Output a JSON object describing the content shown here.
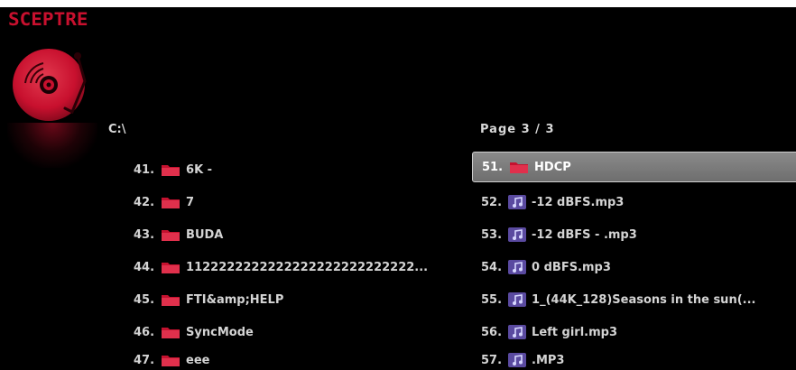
{
  "brand": {
    "logo": "SCEPTRE"
  },
  "header": {
    "path": "C:\\",
    "page": "Page  3 / 3"
  },
  "colors": {
    "brand_red": "#c8102e",
    "folder": "#c4122f",
    "music": "#5a4aa0"
  },
  "left_list": [
    {
      "index": "41.",
      "name": "6K -",
      "icon": "folder-icon"
    },
    {
      "index": "42.",
      "name": "7",
      "icon": "folder-icon"
    },
    {
      "index": "43.",
      "name": "BUDA",
      "icon": "folder-icon"
    },
    {
      "index": "44.",
      "name": "1122222222222222222222222222...",
      "icon": "folder-icon"
    },
    {
      "index": "45.",
      "name": "FTI&amp;HELP",
      "icon": "folder-icon"
    },
    {
      "index": "46.",
      "name": "SyncMode",
      "icon": "folder-icon"
    },
    {
      "index": "47.",
      "name": "eee",
      "icon": "folder-icon"
    }
  ],
  "right_list": [
    {
      "index": "51.",
      "name": "HDCP",
      "icon": "folder-icon",
      "selected": true
    },
    {
      "index": "52.",
      "name": "-12 dBFS.mp3",
      "icon": "music-icon"
    },
    {
      "index": "53.",
      "name": "-12 dBFS - .mp3",
      "icon": "music-icon"
    },
    {
      "index": "54.",
      "name": "0 dBFS.mp3",
      "icon": "music-icon"
    },
    {
      "index": "55.",
      "name": "1_(44K_128)Seasons in the sun(...",
      "icon": "music-icon"
    },
    {
      "index": "56.",
      "name": "Left girl.mp3",
      "icon": "music-icon"
    },
    {
      "index": "57.",
      "name": ".MP3",
      "icon": "music-icon"
    }
  ]
}
